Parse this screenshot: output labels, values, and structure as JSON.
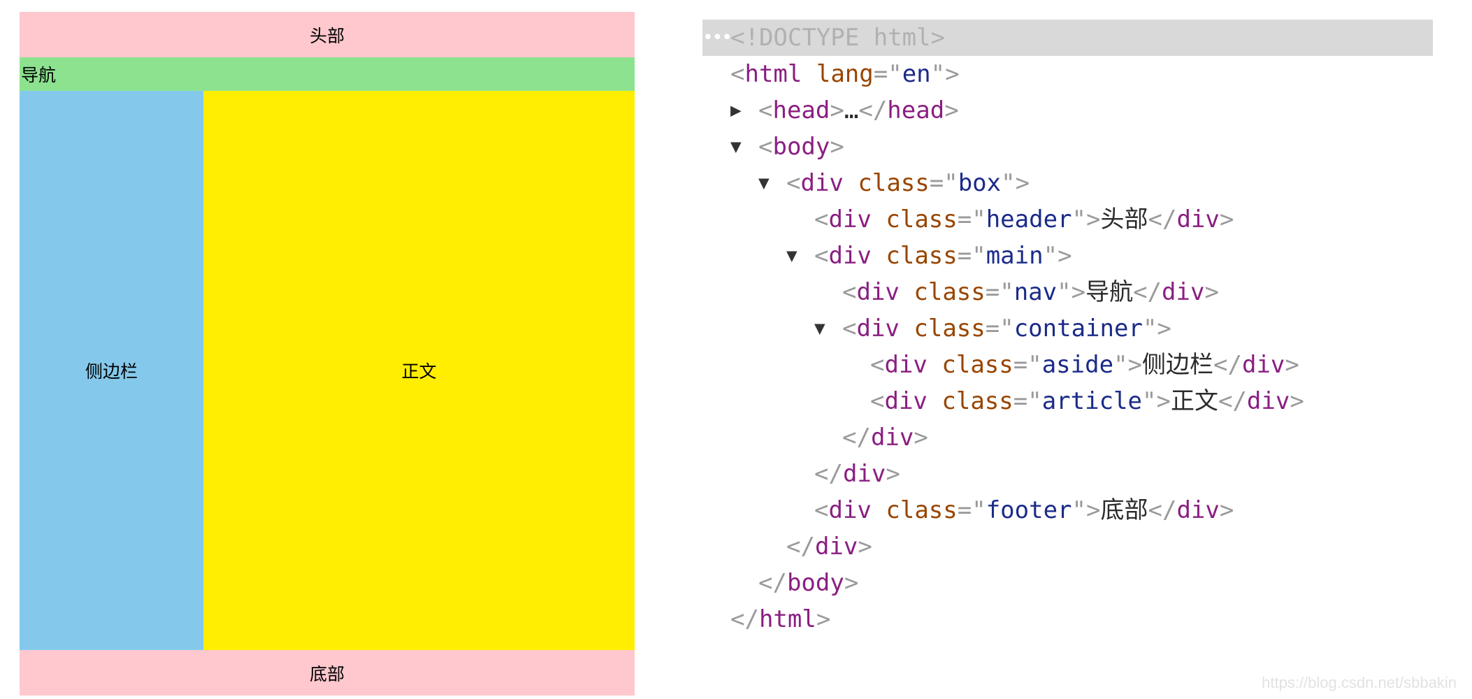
{
  "preview": {
    "header": "头部",
    "nav": "导航",
    "aside": "侧边栏",
    "article": "正文",
    "footer": "底部",
    "colors": {
      "header": "#ffc8ce",
      "nav": "#8de28f",
      "aside": "#84c9ec",
      "article": "#ffee00",
      "footer": "#ffc8ce"
    }
  },
  "devtools": {
    "selected_row_bg": "#d9d9d9",
    "doctype": "<!DOCTYPE html>",
    "html_open": {
      "tag": "html",
      "attr": "lang",
      "value": "en"
    },
    "head": {
      "tag": "head",
      "ellipsis": "…"
    },
    "body": {
      "tag": "body"
    },
    "box": {
      "tag": "div",
      "attr": "class",
      "value": "box"
    },
    "header": {
      "tag": "div",
      "attr": "class",
      "value": "header",
      "text": "头部"
    },
    "main": {
      "tag": "div",
      "attr": "class",
      "value": "main"
    },
    "nav": {
      "tag": "div",
      "attr": "class",
      "value": "nav",
      "text": "导航"
    },
    "container": {
      "tag": "div",
      "attr": "class",
      "value": "container"
    },
    "aside": {
      "tag": "div",
      "attr": "class",
      "value": "aside",
      "text": "侧边栏"
    },
    "article": {
      "tag": "div",
      "attr": "class",
      "value": "article",
      "text": "正文"
    },
    "footer": {
      "tag": "div",
      "attr": "class",
      "value": "footer",
      "text": "底部"
    }
  },
  "watermark": "https://blog.csdn.net/sbbakin"
}
